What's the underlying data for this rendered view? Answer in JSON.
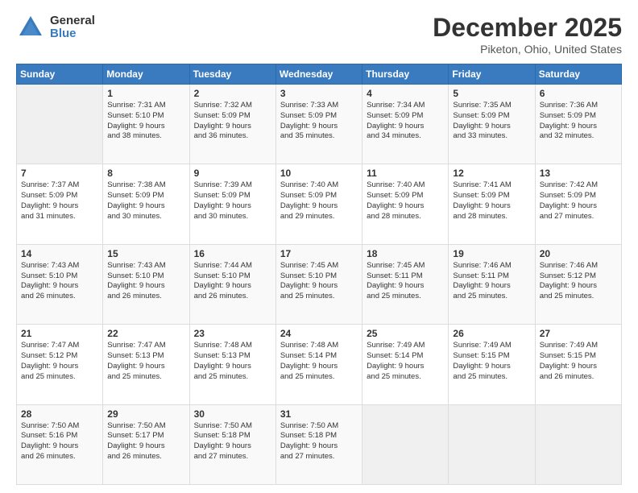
{
  "logo": {
    "general": "General",
    "blue": "Blue"
  },
  "header": {
    "month": "December 2025",
    "location": "Piketon, Ohio, United States"
  },
  "days_of_week": [
    "Sunday",
    "Monday",
    "Tuesday",
    "Wednesday",
    "Thursday",
    "Friday",
    "Saturday"
  ],
  "weeks": [
    [
      {
        "day": "",
        "info": ""
      },
      {
        "day": "1",
        "info": "Sunrise: 7:31 AM\nSunset: 5:10 PM\nDaylight: 9 hours\nand 38 minutes."
      },
      {
        "day": "2",
        "info": "Sunrise: 7:32 AM\nSunset: 5:09 PM\nDaylight: 9 hours\nand 36 minutes."
      },
      {
        "day": "3",
        "info": "Sunrise: 7:33 AM\nSunset: 5:09 PM\nDaylight: 9 hours\nand 35 minutes."
      },
      {
        "day": "4",
        "info": "Sunrise: 7:34 AM\nSunset: 5:09 PM\nDaylight: 9 hours\nand 34 minutes."
      },
      {
        "day": "5",
        "info": "Sunrise: 7:35 AM\nSunset: 5:09 PM\nDaylight: 9 hours\nand 33 minutes."
      },
      {
        "day": "6",
        "info": "Sunrise: 7:36 AM\nSunset: 5:09 PM\nDaylight: 9 hours\nand 32 minutes."
      }
    ],
    [
      {
        "day": "7",
        "info": "Sunrise: 7:37 AM\nSunset: 5:09 PM\nDaylight: 9 hours\nand 31 minutes."
      },
      {
        "day": "8",
        "info": "Sunrise: 7:38 AM\nSunset: 5:09 PM\nDaylight: 9 hours\nand 30 minutes."
      },
      {
        "day": "9",
        "info": "Sunrise: 7:39 AM\nSunset: 5:09 PM\nDaylight: 9 hours\nand 30 minutes."
      },
      {
        "day": "10",
        "info": "Sunrise: 7:40 AM\nSunset: 5:09 PM\nDaylight: 9 hours\nand 29 minutes."
      },
      {
        "day": "11",
        "info": "Sunrise: 7:40 AM\nSunset: 5:09 PM\nDaylight: 9 hours\nand 28 minutes."
      },
      {
        "day": "12",
        "info": "Sunrise: 7:41 AM\nSunset: 5:09 PM\nDaylight: 9 hours\nand 28 minutes."
      },
      {
        "day": "13",
        "info": "Sunrise: 7:42 AM\nSunset: 5:09 PM\nDaylight: 9 hours\nand 27 minutes."
      }
    ],
    [
      {
        "day": "14",
        "info": "Sunrise: 7:43 AM\nSunset: 5:10 PM\nDaylight: 9 hours\nand 26 minutes."
      },
      {
        "day": "15",
        "info": "Sunrise: 7:43 AM\nSunset: 5:10 PM\nDaylight: 9 hours\nand 26 minutes."
      },
      {
        "day": "16",
        "info": "Sunrise: 7:44 AM\nSunset: 5:10 PM\nDaylight: 9 hours\nand 26 minutes."
      },
      {
        "day": "17",
        "info": "Sunrise: 7:45 AM\nSunset: 5:10 PM\nDaylight: 9 hours\nand 25 minutes."
      },
      {
        "day": "18",
        "info": "Sunrise: 7:45 AM\nSunset: 5:11 PM\nDaylight: 9 hours\nand 25 minutes."
      },
      {
        "day": "19",
        "info": "Sunrise: 7:46 AM\nSunset: 5:11 PM\nDaylight: 9 hours\nand 25 minutes."
      },
      {
        "day": "20",
        "info": "Sunrise: 7:46 AM\nSunset: 5:12 PM\nDaylight: 9 hours\nand 25 minutes."
      }
    ],
    [
      {
        "day": "21",
        "info": "Sunrise: 7:47 AM\nSunset: 5:12 PM\nDaylight: 9 hours\nand 25 minutes."
      },
      {
        "day": "22",
        "info": "Sunrise: 7:47 AM\nSunset: 5:13 PM\nDaylight: 9 hours\nand 25 minutes."
      },
      {
        "day": "23",
        "info": "Sunrise: 7:48 AM\nSunset: 5:13 PM\nDaylight: 9 hours\nand 25 minutes."
      },
      {
        "day": "24",
        "info": "Sunrise: 7:48 AM\nSunset: 5:14 PM\nDaylight: 9 hours\nand 25 minutes."
      },
      {
        "day": "25",
        "info": "Sunrise: 7:49 AM\nSunset: 5:14 PM\nDaylight: 9 hours\nand 25 minutes."
      },
      {
        "day": "26",
        "info": "Sunrise: 7:49 AM\nSunset: 5:15 PM\nDaylight: 9 hours\nand 25 minutes."
      },
      {
        "day": "27",
        "info": "Sunrise: 7:49 AM\nSunset: 5:15 PM\nDaylight: 9 hours\nand 26 minutes."
      }
    ],
    [
      {
        "day": "28",
        "info": "Sunrise: 7:50 AM\nSunset: 5:16 PM\nDaylight: 9 hours\nand 26 minutes."
      },
      {
        "day": "29",
        "info": "Sunrise: 7:50 AM\nSunset: 5:17 PM\nDaylight: 9 hours\nand 26 minutes."
      },
      {
        "day": "30",
        "info": "Sunrise: 7:50 AM\nSunset: 5:18 PM\nDaylight: 9 hours\nand 27 minutes."
      },
      {
        "day": "31",
        "info": "Sunrise: 7:50 AM\nSunset: 5:18 PM\nDaylight: 9 hours\nand 27 minutes."
      },
      {
        "day": "",
        "info": ""
      },
      {
        "day": "",
        "info": ""
      },
      {
        "day": "",
        "info": ""
      }
    ]
  ]
}
